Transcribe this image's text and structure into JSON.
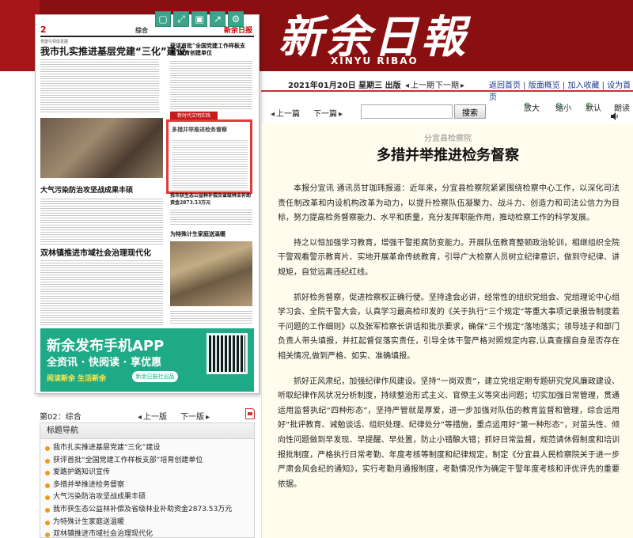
{
  "masthead": {
    "cn": "新余日報",
    "en": "XINYU RIBAO"
  },
  "thumbnail": {
    "toolbar_icons": [
      "window-icon",
      "expand-icon",
      "save-icon",
      "share-icon",
      "settings-icon"
    ],
    "page_no": "2",
    "section": "综合",
    "logo": "新余日报",
    "articles": [
      {
        "kicker": "党建引领促发展",
        "title": "我市扎实推进基层党建“三化”建设"
      },
      {
        "kicker": "",
        "title": "获评首批“全国党建工作样板支部”培育创建单位"
      },
      {
        "kicker": "",
        "title": "多措并举推进检务督察"
      },
      {
        "kicker": "",
        "title": "大气污染防治攻坚战成果丰硕"
      },
      {
        "kicker": "",
        "title": "我市获生态公益林补偿及省级林业补助资金2873.53万元"
      },
      {
        "kicker": "",
        "title": "为特殊计生家庭送温暖"
      },
      {
        "kicker": "",
        "title": "双林镇推进市域社会治理现代化"
      }
    ],
    "red_tag": "新时代文明实践",
    "banner": {
      "title": "新余发布手机APP",
      "subtitle": "全资讯 · 快阅读 · 享优惠",
      "slogan": "阅读新余 生活新余",
      "badge": "新余日报社出品"
    }
  },
  "page_nav": {
    "page": "第02：综合",
    "prev": "上一版",
    "next": "下一版"
  },
  "title_nav": {
    "heading": "标题导航",
    "items": [
      "我市扎实推进基层党建“三化”建设",
      "获评首批“全国党建工作样板支部”培育创建单位",
      "爱路护路知识宣传",
      "多措并举推进检务督察",
      "大气污染防治攻坚战成果丰硕",
      "我市获生态公益林补偿及省级林业补助资金2873.53万元",
      "为特殊计生家庭送温暖",
      "双林镇推进市域社会治理现代化"
    ]
  },
  "datebar": {
    "date": "2021年01月20日 星期三 出版",
    "prev": "上一期",
    "next": "下一期",
    "links": "返回首页 | 版面概览 | 加入收藏 | 设为首页"
  },
  "toolbar": {
    "prev": "上一篇",
    "next": "下一篇",
    "search_value": "",
    "search_button": "搜索",
    "zoom_in": "放大",
    "zoom_out": "缩小",
    "default": "默认",
    "read_aloud": "朗读"
  },
  "article": {
    "source": "分宜县检察院",
    "title": "多措并举推进检务督察",
    "paragraphs": [
      "本报分宜讯 通讯员甘珈玮报道：近年来，分宜县检察院紧紧围绕检察中心工作，以深化司法责任制改革和内设机构改革为动力，以提升检察队伍凝聚力、战斗力、创造力和司法公信力为目标，努力提高检务督察能力、水平和质量，充分发挥职能作用，推动检察工作的科学发展。",
      "持之以恒加强学习教育，增强干警拒腐防变能力。开展队伍教育整顿政治轮训，相继组织全院干警观看警示教育片、实地开展革命传统教育，引导广大检察人员树立纪律意识，做到守纪律、讲规矩，自觉远离违纪红线。",
      "抓好检务督察，促进检察权正确行使。坚持逢会必讲，经常性的组织党组会、党组理论中心组学习会、全院干警大会，认真学习最高检印发的《关于执行“三个规定”等重大事项记录报告制度若干问题的工作细则》以及张军检察长讲话和批示要求，确保“三个规定”落地落实；领导班子和部门负责人带头填报，并扛起督促落实责任，引导全体干警严格对照规定内容,认真查摆自身是否存在相关情况,做到严格、如实、准确填报。",
      "抓好正风肃纪，加强纪律作风建设。坚持“一岗双责”，建立党组定期专题研究党风廉政建设、听取纪律作风状况分析制度，持续整治形式主义、官僚主义等突出问题；切实加强日常管理，贯通运用监督执纪“四种形态”，坚持严管就是厚爱，进一步加强对队伍的教育监督和管理，综合运用好“批评教育、诫勉谈话、组织处理、纪律处分”等措施，重点运用好“第一种形态”，对苗头性、倾向性问题做到早发现、早提醒、早处置，防止小错酿大错；抓好日常监督，规范请休假制度和培训报批制度，严格执行日常考勤、年度考核等制度和纪律规定，制定《分宜县人民检察院关于进一步严肃会风会纪的通知》，实行考勤月通报制度，考勤情况作为确定干警年度考核和评优评先的重要依据。"
    ]
  },
  "colors": {
    "header_bg": "#8a0f10",
    "article_bg": "#fffbed",
    "divider": "#c63335",
    "banner": "#1eaa86",
    "bullet": "#f09a1a"
  }
}
